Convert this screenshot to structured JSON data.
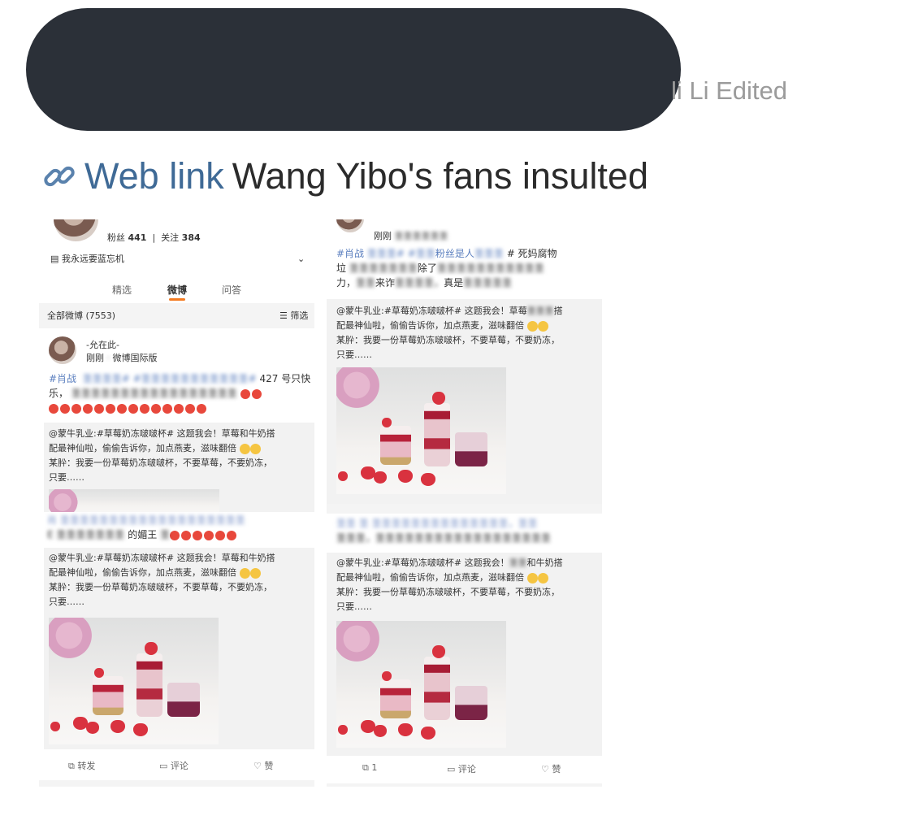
{
  "header": {
    "edited_text": "li Li Edited",
    "link_label": "Web link",
    "headline": "Wang Yibo's fans insulted"
  },
  "left_screenshot": {
    "followers_label": "粉丝",
    "followers_count": "441",
    "following_label": "关注",
    "following_count": "384",
    "bio": "我永远要蓝忘机",
    "tabs": [
      "精选",
      "微博",
      "问答"
    ],
    "all_posts": "全部微博 (7553)",
    "filter": "筛选",
    "post_user": "-允在此-",
    "post_time": "刚刚",
    "post_source": "微博国际版",
    "post_tag": "#肖战",
    "post_line1_tail": "427 号只快",
    "post_line2_head": "乐，",
    "repost_line1": "@蒙牛乳业:#草莓奶冻啵啵杯# 这题我会！草莓和牛奶搭",
    "repost_line2": "配最神仙啦，偷偷告诉你，加点燕麦，滋味翻倍",
    "repost_line3": "某肸：我要一份草莓奶冻啵啵杯，不要草莓，不要奶冻，",
    "repost_line4": "只要……",
    "post2_tag": "肖",
    "post2_line_tail": "的媚王",
    "actions": [
      "转发",
      "评论",
      "赞"
    ]
  },
  "right_screenshot": {
    "post_time": "刚刚",
    "line1": "#肖战",
    "line1_mid": "粉丝是人",
    "line1_tail": "# 死妈腐物",
    "line2": "垃",
    "line2_mid": "除了",
    "line3": "力，",
    "line3_mid": "来诈",
    "line3_tail": "真是",
    "repost_line1": "@蒙牛乳业:#草莓奶冻啵啵杯# 这题我会！草莓",
    "repost_line1_tail": "搭",
    "repost_line2": "配最神仙啦，偷偷告诉你，加点燕麦，滋味翻倍",
    "repost_line3": "某肸：我要一份草莓奶冻啵啵杯，不要草莓，不要奶冻，",
    "repost_line4": "只要……",
    "repost2_line1": "@蒙牛乳业:#草莓奶冻啵啵杯# 这题我会！",
    "repost2_line1_tail": "和牛奶搭",
    "actions": [
      "1",
      "评论",
      "赞"
    ]
  }
}
